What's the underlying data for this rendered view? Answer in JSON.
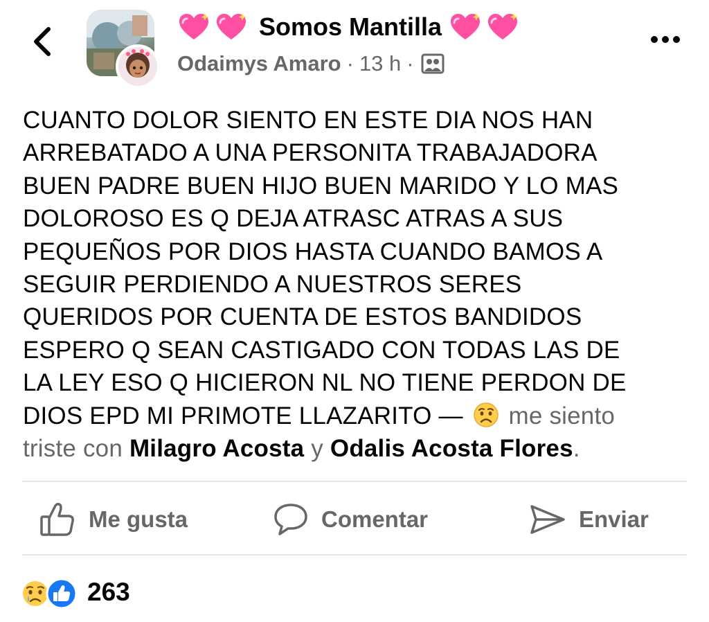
{
  "header": {
    "back_icon": "chevron-left-icon",
    "group_name": "Somos Mantilla",
    "group_name_decoration": "sparkling-heart-icon",
    "author": "Odaimys Amaro",
    "separator": "·",
    "time": "13 h",
    "audience_icon": "group-audience-icon",
    "more_icon": "more-horizontal-icon"
  },
  "post": {
    "lines": [
      "CUANTO DOLOR SIENTO EN ESTE DIA NOS HAN",
      "ARREBATADO A UNA PERSONITA  TRABAJADORA",
      "BUEN PADRE BUEN HIJO  BUEN MARIDO Y LO MAS",
      "DOLOROSO ES Q DEJA ATRASC ATRAS A SUS",
      "PEQUEÑOS  POR DIOS HASTA CUANDO BAMOS A",
      "SEGUIR PERDIENDO A NUESTROS SERES",
      "QUERIDOS POR CUENTA DE ESTOS BANDIDOS",
      "ESPERO Q SEAN CASTIGADO CON TODAS LAS DE",
      "LA LEY  ESO Q HICIERON NL  NO TIENE PERDON DE"
    ],
    "last_line_text": "DIOS EPD MI PRIMOTE  LLAZARITO — ",
    "feeling_icon": "sad-face-icon",
    "feeling_text": " me siento",
    "feeling_text_2": "triste con ",
    "tagged_1": "Milagro Acosta",
    "tag_joiner": " y ",
    "tagged_2": "Odalis Acosta Flores",
    "end_period": "."
  },
  "actions": {
    "like_label": "Me gusta",
    "comment_label": "Comentar",
    "send_label": "Enviar"
  },
  "reactions": {
    "icons": [
      "sad-reaction-icon",
      "like-reaction-icon"
    ],
    "count": "263"
  },
  "colors": {
    "text_primary": "#050505",
    "text_secondary": "#65676b",
    "divider": "#e4e6eb",
    "like_blue": "#1877f2",
    "heart_pink": "#ff4fa3"
  }
}
